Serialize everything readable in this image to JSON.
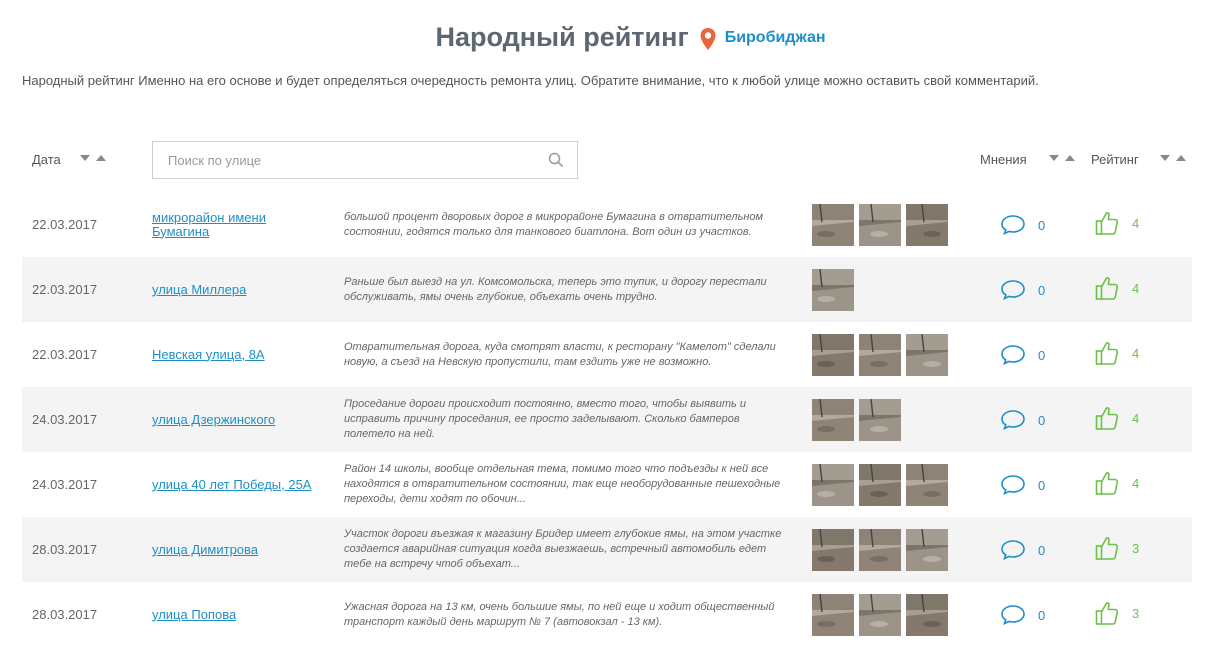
{
  "header": {
    "title": "Народный рейтинг",
    "city": "Биробиджан"
  },
  "intro": "Народный рейтинг Именно на его основе и будет определяться очередность ремонта улиц. Обратите внимание, что к любой улице можно оставить свой комментарий.",
  "toolbar": {
    "date_label": "Дата",
    "search_placeholder": "Поиск по улице",
    "opinions_label": "Мнения",
    "rating_label": "Рейтинг"
  },
  "rows": [
    {
      "date": "22.03.2017",
      "street": "микрорайон имени Бумагина",
      "comment": "большой процент дворовых дорог в микрорайоне Бумагина в отвратительном состоянии, годятся только для танкового биатлона. Вот один из участков.",
      "photos": 3,
      "opinions": "0",
      "rating": "4"
    },
    {
      "date": "22.03.2017",
      "street": "улица Миллера",
      "comment": "Раньше был выезд на ул. Комсомольска, теперь это тупик, и дорогу перестали обслуживать, ямы очень глубокие, объехать очень трудно.",
      "photos": 1,
      "opinions": "0",
      "rating": "4"
    },
    {
      "date": "22.03.2017",
      "street": "Невская улица, 8А",
      "comment": "Отвратительная дорога, куда смотрят власти, к ресторану \"Камелот\" сделали новую, а съезд на Невскую пропустили, там ездить уже не возможно.",
      "photos": 3,
      "opinions": "0",
      "rating": "4"
    },
    {
      "date": "24.03.2017",
      "street": "улица Дзержинского",
      "comment": "Проседание дороги происходит постоянно, вместо того, чтобы выявить и исправить причину проседания, ее просто заделывают. Сколько бамперов полетело на ней.",
      "photos": 2,
      "opinions": "0",
      "rating": "4"
    },
    {
      "date": "24.03.2017",
      "street": "улица 40 лет Победы, 25А",
      "comment": "Район 14 школы, вообще отдельная тема, помимо того что подъезды к ней все находятся в отвратительном состоянии, так еще необорудованные пешеходные переходы, дети ходят по обочин...",
      "photos": 3,
      "opinions": "0",
      "rating": "4"
    },
    {
      "date": "28.03.2017",
      "street": "улица Димитрова",
      "comment": "Участок дороги въезжая к магазину Бридер имеет глубокие ямы, на этом участке создается аварийная ситуация когда выезжаешь, встречный автомобиль едет тебе на встречу чтоб объехат...",
      "photos": 3,
      "opinions": "0",
      "rating": "3"
    },
    {
      "date": "28.03.2017",
      "street": "улица Попова",
      "comment": "Ужасная дорога на 13 км, очень большие ямы, по ней еще и ходит общественный транспорт каждый день маршрут № 7 (автовокзал - 13 км).",
      "photos": 3,
      "opinions": "0",
      "rating": "3"
    }
  ],
  "colors": {
    "accent": "#1e8fc6",
    "rating_green": "#6cc04a",
    "pin": "#e8643c",
    "title": "#5d6673"
  }
}
